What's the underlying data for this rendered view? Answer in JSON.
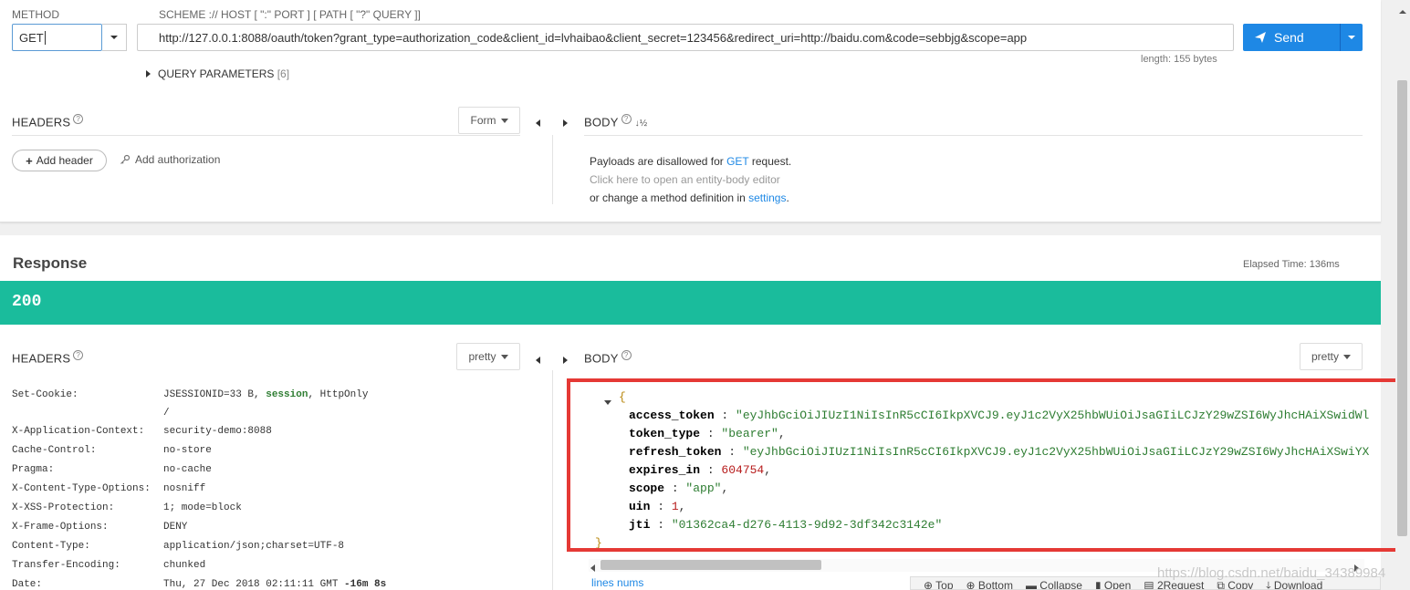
{
  "request": {
    "method_label": "METHOD",
    "method_value": "GET",
    "scheme_label": "SCHEME :// HOST [ \":\" PORT ] [ PATH [ \"?\" QUERY ]]",
    "url": "http://127.0.0.1:8088/oauth/token?grant_type=authorization_code&client_id=lvhaibao&client_secret=123456&redirect_uri=http://baidu.com&code=sebbjg&scope=app",
    "length_text": "length: 155 bytes",
    "send_label": "Send",
    "query_params_label": "QUERY PARAMETERS",
    "query_params_count": "[6]",
    "headers_title": "HEADERS",
    "form_label": "Form",
    "add_header_label": "Add header",
    "add_authorization_label": "Add authorization",
    "body_title": "BODY",
    "body_message": {
      "part1": "Payloads are disallowed for ",
      "method": "GET",
      "part2": " request.",
      "line2": "Click here to open an entity-body editor",
      "line3_part1": "or change a method definition in ",
      "settings_link": "settings",
      "line3_part2": "."
    }
  },
  "response": {
    "title": "Response",
    "elapsed_label": "Elapsed Time: 136ms",
    "status_code": "200",
    "status_color": "#1abc9c",
    "headers_title": "HEADERS",
    "pretty_label": "pretty",
    "body_title": "BODY",
    "body_pretty_label": "pretty",
    "headers": [
      {
        "key": "Set-Cookie:",
        "value": "JSESSIONID=33 B, session, HttpOnly"
      },
      {
        "key": "",
        "value": "/"
      },
      {
        "key": "X-Application-Context:",
        "value": "security-demo:8088"
      },
      {
        "key": "Cache-Control:",
        "value": "no-store"
      },
      {
        "key": "Pragma:",
        "value": "no-cache"
      },
      {
        "key": "X-Content-Type-Options:",
        "value": "nosniff"
      },
      {
        "key": "X-XSS-Protection:",
        "value": "1; mode=block"
      },
      {
        "key": "X-Frame-Options:",
        "value": "DENY"
      },
      {
        "key": "Content-Type:",
        "value": "application/json;charset=UTF-8"
      },
      {
        "key": "Transfer-Encoding:",
        "value": "chunked"
      },
      {
        "key": "Date:",
        "value": "Thu, 27 Dec 2018 02:11:11 GMT -16m 8s"
      }
    ],
    "json": {
      "open_brace": "{",
      "close_brace": "}",
      "fields": [
        {
          "key": "access_token",
          "value": "\"eyJhbGciOiJIUzI1NiIsInR5cCI6IkpXVCJ9.eyJ1c2VyX25hbWUiOiJsaGIiLCJzY29wZSI6WyJhcHAiXSwidWl",
          "type": "str",
          "comma": ""
        },
        {
          "key": "token_type",
          "value": "\"bearer\"",
          "type": "str",
          "comma": ","
        },
        {
          "key": "refresh_token",
          "value": "\"eyJhbGciOiJIUzI1NiIsInR5cCI6IkpXVCJ9.eyJ1c2VyX25hbWUiOiJsaGIiLCJzY29wZSI6WyJhcHAiXSwiYX",
          "type": "str",
          "comma": ""
        },
        {
          "key": "expires_in",
          "value": "604754",
          "type": "num",
          "comma": ","
        },
        {
          "key": "scope",
          "value": "\"app\"",
          "type": "str",
          "comma": ","
        },
        {
          "key": "uin",
          "value": "1",
          "type": "num",
          "comma": ","
        },
        {
          "key": "jti",
          "value": "\"01362ca4-d276-4113-9d92-3df342c3142e\"",
          "type": "str",
          "comma": ""
        }
      ]
    },
    "lines_nums_label": "lines nums",
    "toolbar": [
      "Top",
      "Bottom",
      "Collapse",
      "Open",
      "2Request",
      "Copy",
      "Download"
    ]
  },
  "watermark": "https://blog.csdn.net/baidu_34389984"
}
